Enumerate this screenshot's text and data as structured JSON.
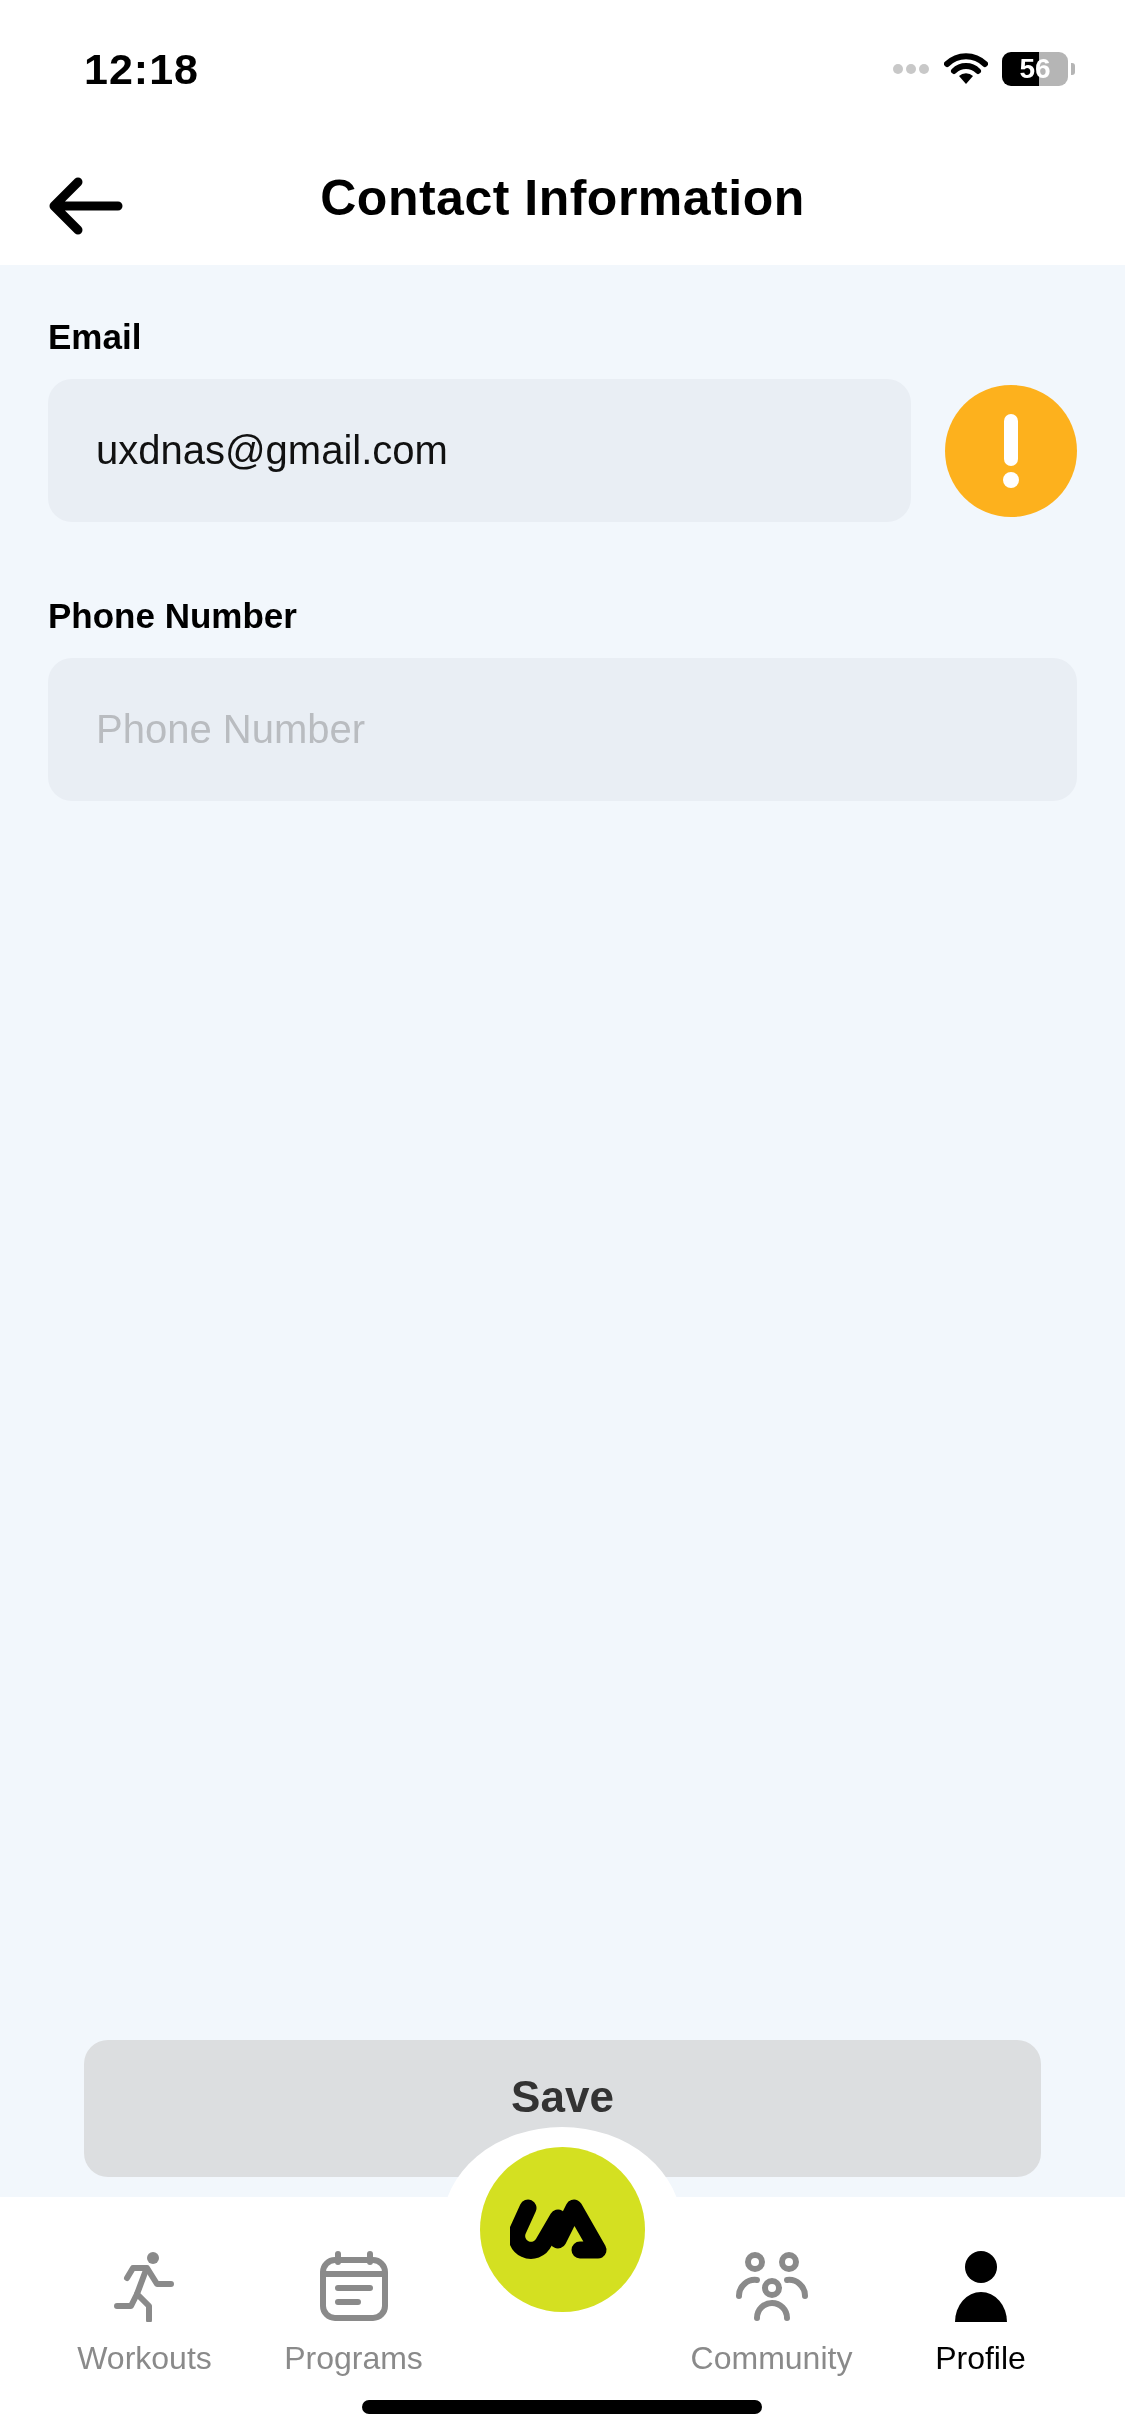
{
  "status_bar": {
    "time": "12:18",
    "battery": "56"
  },
  "header": {
    "title": "Contact Information"
  },
  "fields": [
    {
      "label": "Email",
      "value": "uxdnas@gmail.com",
      "warning": true
    },
    {
      "label": "Phone Number",
      "placeholder": "Phone Number",
      "warning": false
    }
  ],
  "save_button": {
    "label": "Save",
    "disabled": true
  },
  "tabs": [
    {
      "kind": "workouts",
      "label": "Workouts",
      "selected": false
    },
    {
      "kind": "programs",
      "label": "Programs",
      "selected": false
    },
    {
      "kind": "home"
    },
    {
      "kind": "community",
      "label": "Community",
      "selected": false
    },
    {
      "kind": "profile",
      "label": "Profile",
      "selected": true
    }
  ]
}
